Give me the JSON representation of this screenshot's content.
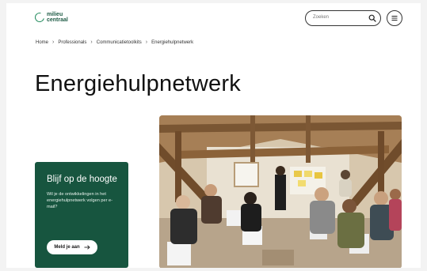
{
  "header": {
    "logo_line1": "milieu",
    "logo_line2": "centraal",
    "search_placeholder": "Zoeken",
    "icons": {
      "search": "search-icon",
      "menu": "menu-icon"
    }
  },
  "breadcrumb": [
    "Home",
    "Professionals",
    "Communicatietoolkits",
    "Energiehulpnetwerk"
  ],
  "page_title": "Energiehulpnetwerk",
  "newsletter": {
    "title": "Blijf op de hoogte",
    "text": "Wil je de ontwikkelingen in het energiehulpnetwerk volgen per e-mail?",
    "button_label": "Meld je aan",
    "button_icon": "arrow-right-icon"
  },
  "colors": {
    "brand_green": "#17553f",
    "logo_green": "#1f8a5b",
    "background": "#ffffff"
  }
}
